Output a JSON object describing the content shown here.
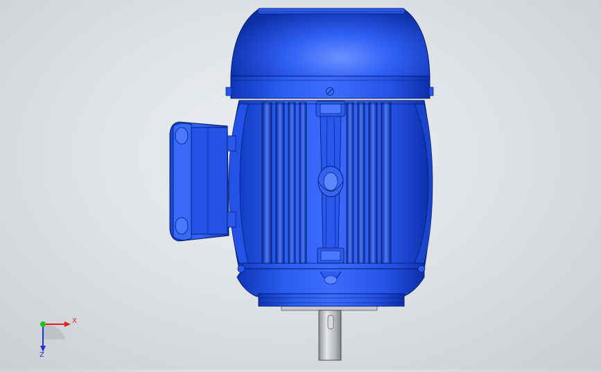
{
  "model": {
    "name": "three-phase-electric-motor",
    "view": "top",
    "body_color": "#1f4fe0",
    "body_highlight": "#5b86ff",
    "body_shadow": "#0b2a8e",
    "outline_color": "#001a66",
    "shaft_color": "#b8bcc2"
  },
  "triad": {
    "x_label": "X",
    "z_label": "Z",
    "x_color": "#e02020",
    "y_color": "#20c020",
    "z_color": "#2030d0"
  }
}
